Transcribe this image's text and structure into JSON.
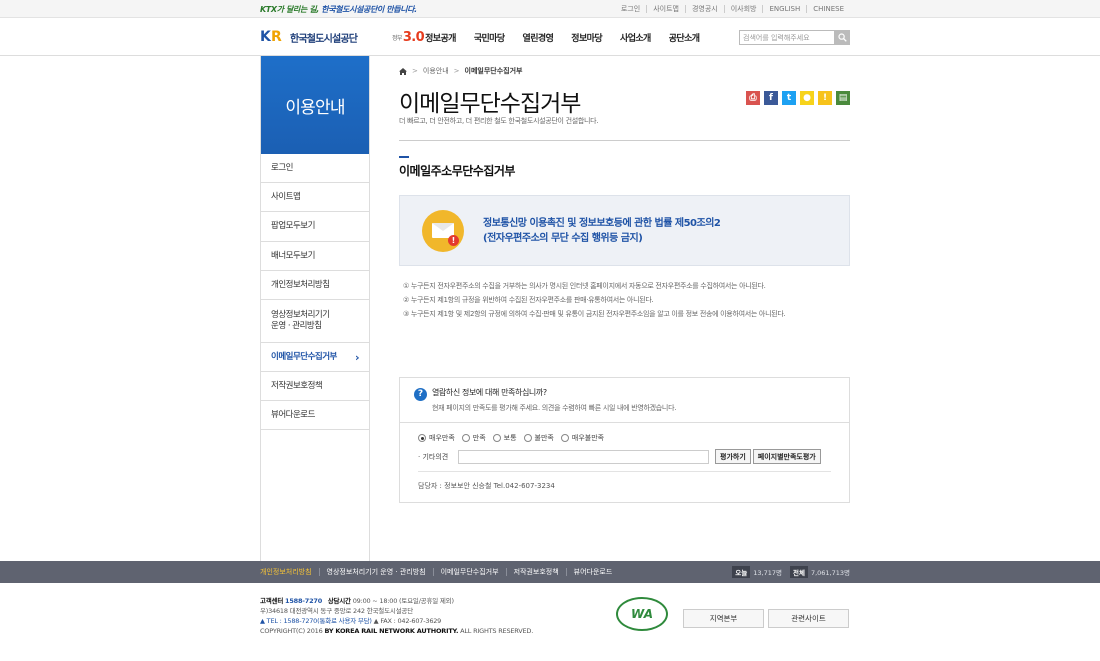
{
  "topbar": {
    "slogan_prefix": "KTX가 달리는 길,",
    "slogan_main": "한국철도시설공단이 만듭니다.",
    "links": [
      "로그인",
      "사이트맵",
      "경영공시",
      "이사회방",
      "ENGLISH",
      "CHINESE"
    ]
  },
  "header": {
    "logo_text": "한국철도시설공단",
    "logo_mark_k": "K",
    "logo_mark_r": "R",
    "gnb_first_small": "정부",
    "gnb_first_num": "3.0",
    "gnb": [
      "정보공개",
      "국민마당",
      "열린경영",
      "정보마당",
      "사업소개",
      "공단소개"
    ],
    "search_placeholder": "검색어를 입력해주세요"
  },
  "lnb": {
    "title": "이용안내",
    "items": [
      {
        "label": "로그인"
      },
      {
        "label": "사이트맵"
      },
      {
        "label": "팝업모두보기"
      },
      {
        "label": "배너모두보기"
      },
      {
        "label": "개인정보처리방침"
      },
      {
        "label": "영상정보처리기기\n운영 · 관리방침"
      },
      {
        "label": "이메일무단수집거부",
        "active": true
      },
      {
        "label": "저작권보호정책"
      },
      {
        "label": "뷰어다운로드"
      }
    ],
    "active_arrow": "›"
  },
  "breadcrumb": {
    "home_icon": "home-icon",
    "level1": "이용안내",
    "current": "이메일무단수집거부",
    "sep": ">"
  },
  "page": {
    "title": "이메일무단수집거부",
    "desc": "더 빠르고, 더 안전하고, 더 편리한 철도 한국철도시설공단이 건설합니다.",
    "section_title": "이메일주소무단수집거부",
    "law_line1": "정보통신망 이용촉진 및 정보보호등에 관한 법률 제50조의2",
    "law_line2": "(전자우편주소의 무단 수집 행위등 금지)",
    "rules": [
      "① 누구든지 전자우편주소의 수집을 거부하는 의사가 명시된 인터넷 홈페이지에서 자동으로 전자우편주소를 수집하여서는 아니된다.",
      "② 누구든지 제1항의 규정을 위반하여 수집된 전자우편주소를 판매·유통하여서는 아니된다.",
      "③ 누구든지 제1항 및 제2항의 규정에 의하여 수집·판매 및 유통이 금지된 전자우편주소임을 알고 이를 정보 전송에 이용하여서는 아니된다."
    ]
  },
  "sns": [
    {
      "icon": "print-icon",
      "color": "#d9534f",
      "glyph": "⎙"
    },
    {
      "icon": "facebook-icon",
      "color": "#3b5998",
      "glyph": "f"
    },
    {
      "icon": "twitter-icon",
      "color": "#1da1f2",
      "glyph": "t"
    },
    {
      "icon": "kakaotalk-icon",
      "color": "#f7d31b",
      "glyph": "●"
    },
    {
      "icon": "kakaostory-icon",
      "color": "#f7c31b",
      "glyph": "!"
    },
    {
      "icon": "band-icon",
      "color": "#4a8a3c",
      "glyph": "▤"
    }
  ],
  "survey": {
    "question": "열람하신 정보에 대해 만족하십니까?",
    "desc": "현재 페이지의 만족도를 평가해 주세요. 의견을 수렴하여 빠른 시일 내에 반영하겠습니다.",
    "options": [
      "매우만족",
      "만족",
      "보통",
      "불만족",
      "매우불만족"
    ],
    "selected": "매우만족",
    "opinion_label": "· 기타의견",
    "submit": "평가하기",
    "per_page": "페이지별만족도평가",
    "manager": "담당자 : 정보보안 신승철 Tel.042-607-3234"
  },
  "footer_nav": {
    "links": [
      "개인정보처리방침",
      "영상정보처리기기 운영 · 관리방침",
      "이메일무단수집거부",
      "저작권보호정책",
      "뷰어다운로드"
    ],
    "today_label": "오늘",
    "today_value": "13,717명",
    "total_label": "전체",
    "total_value": "7,061,713명"
  },
  "footer": {
    "center_label": "고객센터",
    "center_tel": "1588-7270",
    "hours_label": "상담시간",
    "hours": "09:00 ~ 18:00 (토요일/공휴일 제외)",
    "address": "우)34618 대전광역시 동구 중앙로 242 한국철도시설공단",
    "tel_line": "TEL : 1588-7270(통화료 사용자 부담)",
    "fax_line": "FAX : 042-607-3629",
    "copyright_prefix": "COPYRIGHT(C) 2016",
    "copyright_org": "BY KOREA RAIL NETWORK AUTHORITY.",
    "copyright_suffix": "ALL RIGHTS RESERVED.",
    "wa_mark": "WA",
    "btn_region": "지역본부",
    "btn_related": "관련사이트"
  }
}
